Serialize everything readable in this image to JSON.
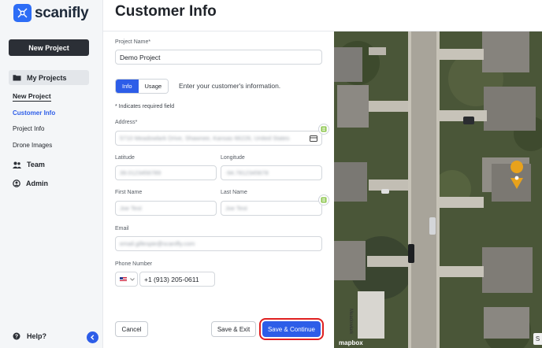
{
  "brand": {
    "name": "scanifly",
    "accent": "#2d5de8"
  },
  "sidebar": {
    "new_project_button": "New Project",
    "my_projects": "My Projects",
    "sub_new_project": "New Project",
    "sub_customer_info": "Customer Info",
    "sub_project_info": "Project Info",
    "sub_drone_images": "Drone Images",
    "team": "Team",
    "admin": "Admin",
    "help": "Help?"
  },
  "page": {
    "title": "Customer Info"
  },
  "form": {
    "project_name_label": "Project Name*",
    "project_name_value": "Demo Project",
    "tabs": [
      "Info",
      "Usage"
    ],
    "tab_hint": "Enter your customer's information.",
    "required_note": "* Indicates required field",
    "address_label": "Address*",
    "address_value": "5710 Meadowlark Drive, Shawnee, Kansas 66226, United States",
    "latitude_label": "Latitude",
    "latitude_value": "39.0123456789",
    "longitude_label": "Longitude",
    "longitude_value": "-94.7812345678",
    "first_name_label": "First Name",
    "first_name_value": "Joe Test",
    "last_name_label": "Last Name",
    "last_name_value": "Joe Test",
    "email_label": "Email",
    "email_value": "email.gillespie@scanifly.com",
    "phone_label": "Phone Number",
    "phone_value": "+1 (913) 205-0611",
    "cancel_button": "Cancel",
    "save_exit_button": "Save & Exit",
    "save_continue_button": "Save & Continue"
  },
  "map": {
    "provider_logo": "mapbox",
    "street_label": "Meadowlark",
    "attribution_short": "S"
  }
}
